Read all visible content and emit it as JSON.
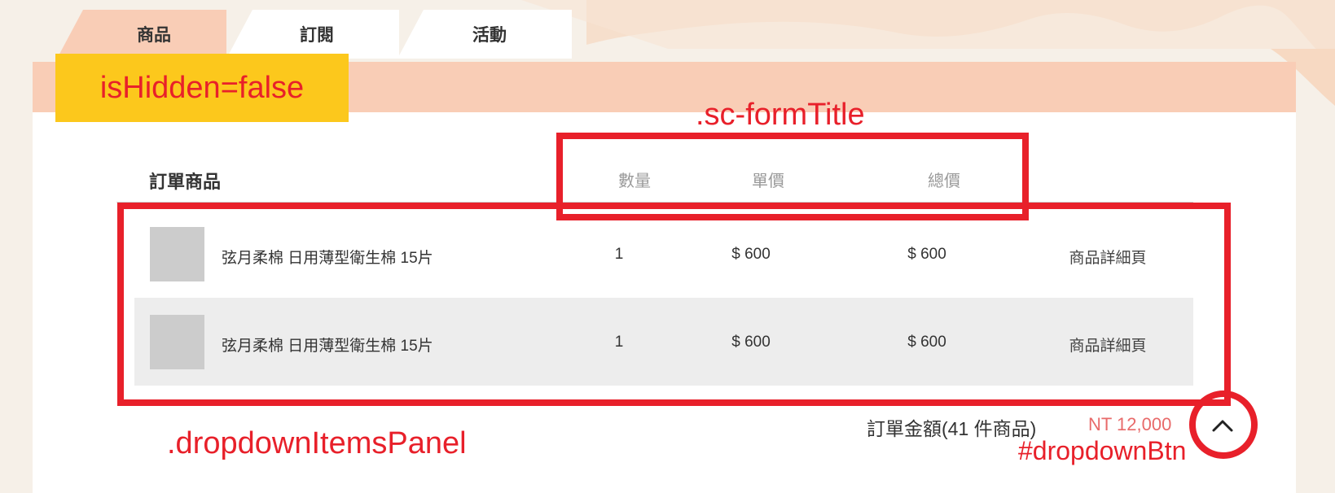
{
  "tabs": [
    {
      "label": "商品"
    },
    {
      "label": "訂閱"
    },
    {
      "label": "活動"
    }
  ],
  "table": {
    "headers": {
      "product": "訂單商品",
      "quantity": "數量",
      "unit_price": "單價",
      "total_price": "總價"
    },
    "rows": [
      {
        "name": "弦月柔棉 日用薄型衛生棉 15片",
        "quantity": "1",
        "unit_price": "$ 600",
        "total_price": "$ 600",
        "link": "商品詳細頁"
      },
      {
        "name": "弦月柔棉 日用薄型衛生棉 15片",
        "quantity": "1",
        "unit_price": "$ 600",
        "total_price": "$ 600",
        "link": "商品詳細頁"
      }
    ]
  },
  "summary": {
    "label": "訂單金額(41 件商品)",
    "price": "NT 12,000"
  },
  "dropdown_button": {
    "icon": "chevron-up-icon"
  },
  "annotations": {
    "is_hidden": "isHidden=false",
    "form_title": ".sc-formTitle",
    "items_panel": ".dropdownItemsPanel",
    "dropdown_btn": "#dropdownBtn"
  },
  "colors": {
    "accent": "#e8202a",
    "tab_active": "#f9cdb6",
    "price": "#e86a6a",
    "highlight": "#fcc81c"
  }
}
